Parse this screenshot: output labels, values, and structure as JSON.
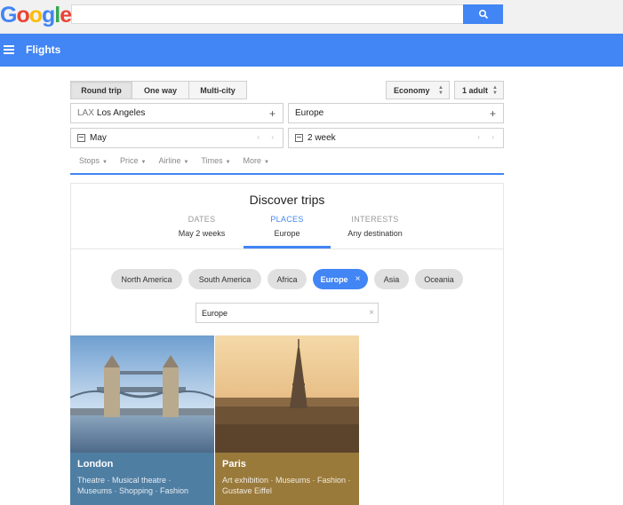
{
  "header": {
    "logo_letters": [
      {
        "ch": "G",
        "color": "#4285f4"
      },
      {
        "ch": "o",
        "color": "#ea4335"
      },
      {
        "ch": "o",
        "color": "#fbbc05"
      },
      {
        "ch": "g",
        "color": "#4285f4"
      },
      {
        "ch": "l",
        "color": "#34a853"
      },
      {
        "ch": "e",
        "color": "#ea4335"
      }
    ],
    "search_value": "",
    "search_icon": "search-icon"
  },
  "nav": {
    "title": "Flights",
    "menu_icon": "hamburger-icon"
  },
  "trip_type": {
    "options": [
      "Round trip",
      "One way",
      "Multi-city"
    ],
    "selected": "Round trip"
  },
  "cabin": {
    "value": "Economy"
  },
  "passengers": {
    "value": "1 adult"
  },
  "origin": {
    "code": "LAX",
    "city": "Los Angeles"
  },
  "destination": {
    "value": "Europe"
  },
  "depart": {
    "value": "May"
  },
  "duration": {
    "value": "2 week"
  },
  "filters": [
    "Stops",
    "Price",
    "Airline",
    "Times",
    "More"
  ],
  "discover": {
    "title": "Discover trips",
    "tabs": [
      {
        "label": "DATES",
        "value": "May 2 weeks"
      },
      {
        "label": "PLACES",
        "value": "Europe"
      },
      {
        "label": "INTERESTS",
        "value": "Any destination"
      }
    ],
    "active_tab": "PLACES"
  },
  "regions": [
    "North America",
    "South America",
    "Africa",
    "Europe",
    "Asia",
    "Oceania"
  ],
  "selected_region": "Europe",
  "region_input": {
    "value": "Europe"
  },
  "cards": [
    {
      "city": "London",
      "tags": "Theatre · Musical theatre · Museums · Shopping · Fashion",
      "color": "#4f7ea3"
    },
    {
      "city": "Paris",
      "tags": "Art exhibition · Museums · Fashion · Gustave Eiffel",
      "color": "#9a7a3a"
    }
  ],
  "colors": {
    "accent": "#4285f4",
    "topbar": "#f1f1f1"
  }
}
